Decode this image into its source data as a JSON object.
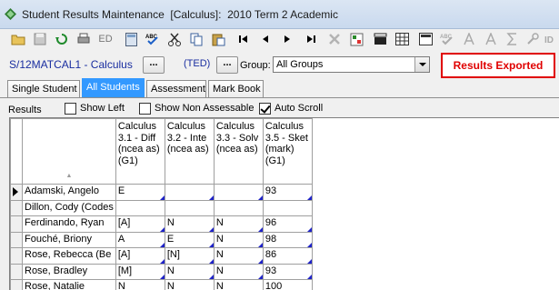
{
  "window": {
    "title": "Student Results Maintenance  [Calculus]:  2010 Term 2 Academic"
  },
  "toolbar": {
    "icons": [
      "open-folder-icon",
      "save-icon",
      "refresh-icon",
      "print-icon",
      "edit-icon",
      "calculator-icon",
      "spellcheck-icon",
      "cut-icon",
      "copy-icon",
      "paste-icon",
      "first-record-icon",
      "previous-record-icon",
      "next-record-icon",
      "last-record-icon",
      "delete-icon",
      "find-icon",
      "film-clapper-icon",
      "grid-icon",
      "spellcheck2-icon",
      "font-a-icon",
      "font-a-small-icon",
      "sum-icon",
      "wrench-icon",
      "id-icon"
    ],
    "ed_label": "ED"
  },
  "filter": {
    "course": "S/12MATCAL1 - Calculus",
    "course_button": "...",
    "teacher": "(TED)",
    "teacher_button": "...",
    "group_label": "Group:",
    "group_value": "All Groups",
    "status_badge": "Results Exported"
  },
  "tabs": [
    {
      "label": "Single Student",
      "active": false
    },
    {
      "label": "All Students",
      "active": true
    },
    {
      "label": "Assessment",
      "active": false
    },
    {
      "label": "Mark Book",
      "active": false
    }
  ],
  "options": {
    "results_label": "Results",
    "show_left": {
      "label": "Show Left",
      "checked": false
    },
    "show_non_assessable": {
      "label": "Show Non Assessable",
      "checked": false
    },
    "auto_scroll": {
      "label": "Auto Scroll",
      "checked": true
    }
  },
  "grid": {
    "columns": [
      "Calculus 3.1 - Diff (ncea as) (G1)",
      "Calculus 3.2 - Inte (ncea as)",
      "Calculus 3.3 - Solv (ncea as)",
      "Calculus 3.5 - Sket (mark) (G1)"
    ],
    "rows": [
      {
        "name": "Adamski, Angelo",
        "values": [
          "E",
          "",
          "",
          "93"
        ],
        "current": true
      },
      {
        "name": "Dillon, Cody (Codes",
        "values": [
          "",
          "",
          "",
          ""
        ],
        "current": false
      },
      {
        "name": "Ferdinando, Ryan",
        "values": [
          "[A]",
          "N",
          "N",
          "96"
        ],
        "current": false
      },
      {
        "name": "Fouché, Briony",
        "values": [
          "A",
          "E",
          "N",
          "98"
        ],
        "current": false
      },
      {
        "name": "Rose, Rebecca (Be",
        "values": [
          "[A]",
          "[N]",
          "N",
          "86"
        ],
        "current": false
      },
      {
        "name": "Rose, Bradley",
        "values": [
          "[M]",
          "N",
          "N",
          "93"
        ],
        "current": false
      },
      {
        "name": "Rose, Natalie",
        "values": [
          "N",
          "N",
          "N",
          "100"
        ],
        "current": false
      }
    ]
  }
}
